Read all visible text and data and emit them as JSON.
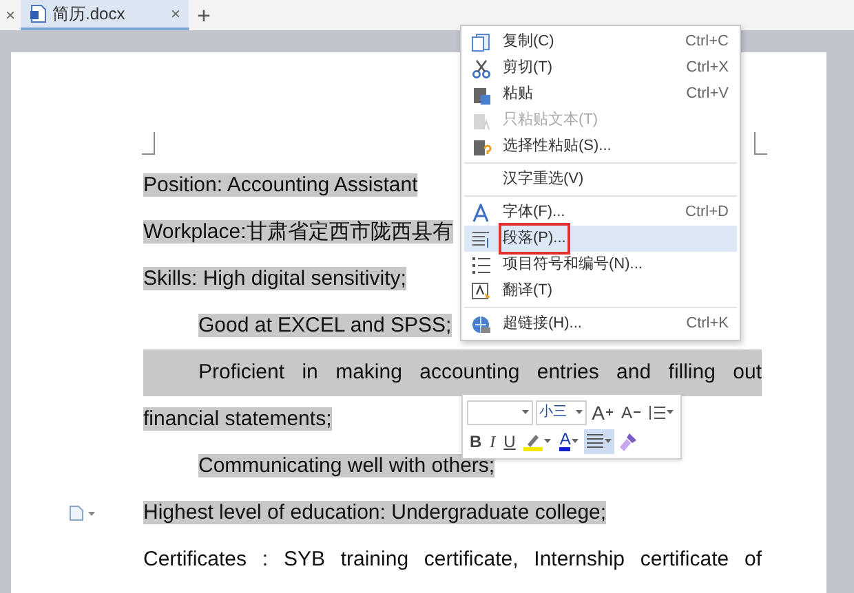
{
  "tabbar": {
    "prev_close": "×",
    "add": "+"
  },
  "tabs": [
    {
      "label": "简历.docx",
      "close": "×",
      "selected": true
    }
  ],
  "paragraphs": [
    {
      "lines": [
        {
          "text": "Position: Accounting Assistant",
          "justified": false
        }
      ],
      "selected": true,
      "indent": false,
      "marker": false
    },
    {
      "lines": [
        {
          "text": "Workplace:甘肃省定西市陇西县有",
          "justified": false
        }
      ],
      "selected": true,
      "indent": false,
      "marker": false
    },
    {
      "lines": [
        {
          "text": "Skills: High digital sensitivity;",
          "justified": false
        }
      ],
      "selected": true,
      "indent": false,
      "marker": false
    },
    {
      "lines": [
        {
          "text": "Good at EXCEL and SPSS;",
          "justified": false
        }
      ],
      "selected": true,
      "indent": true,
      "marker": false
    },
    {
      "lines": [
        {
          "text": "Proficient in making accounting entries and filling out",
          "justified": true
        },
        {
          "text": "financial statements;",
          "justified": false
        }
      ],
      "selected": true,
      "indent": true,
      "marker": false
    },
    {
      "lines": [
        {
          "text": "Communicating well with others;",
          "justified": false
        }
      ],
      "selected": true,
      "indent": true,
      "marker": false
    },
    {
      "lines": [
        {
          "text": "Highest level of education: Undergraduate college;",
          "justified": false
        }
      ],
      "selected": true,
      "indent": false,
      "marker": true
    },
    {
      "lines": [
        {
          "text": "Certificates : SYB training   certificate,   Internship certificate of",
          "justified": true
        }
      ],
      "selected": false,
      "indent": false,
      "marker": false
    }
  ],
  "context_menu": [
    {
      "kind": "copy",
      "label": "复制(C)",
      "shortcut": "Ctrl+C",
      "disabled": false,
      "selected": false,
      "separator_before": false,
      "boxed": false
    },
    {
      "kind": "cut",
      "label": "剪切(T)",
      "shortcut": "Ctrl+X",
      "disabled": false,
      "selected": false,
      "separator_before": false,
      "boxed": false
    },
    {
      "kind": "paste",
      "label": "粘贴",
      "shortcut": "Ctrl+V",
      "disabled": false,
      "selected": false,
      "separator_before": false,
      "boxed": false
    },
    {
      "kind": "paste-text",
      "label": "只粘贴文本(T)",
      "disabled": true,
      "selected": false,
      "separator_before": false,
      "boxed": false
    },
    {
      "kind": "paste-special",
      "label": "选择性粘贴(S)...",
      "disabled": false,
      "selected": false,
      "separator_before": false,
      "boxed": false
    },
    {
      "kind": "plain",
      "label": "汉字重选(V)",
      "disabled": false,
      "selected": false,
      "separator_before": true,
      "boxed": false
    },
    {
      "kind": "font",
      "label": "字体(F)...",
      "shortcut": "Ctrl+D",
      "disabled": false,
      "selected": false,
      "separator_before": true,
      "boxed": false
    },
    {
      "kind": "paragraph",
      "label": "段落(P)...",
      "disabled": false,
      "selected": true,
      "separator_before": false,
      "boxed": true
    },
    {
      "kind": "list",
      "label": "项目符号和编号(N)...",
      "disabled": false,
      "selected": false,
      "separator_before": false,
      "boxed": false
    },
    {
      "kind": "translate",
      "label": "翻译(T)",
      "disabled": false,
      "selected": false,
      "separator_before": false,
      "boxed": false
    },
    {
      "kind": "link",
      "label": "超链接(H)...",
      "shortcut": "Ctrl+K",
      "disabled": false,
      "selected": false,
      "separator_before": true,
      "boxed": false
    }
  ],
  "mini_toolbar": {
    "font_size": "小三",
    "row_1": [
      {
        "kind": "grow",
        "label": "A",
        "selected": false
      },
      {
        "kind": "shrink",
        "label": "A",
        "selected": false
      },
      {
        "kind": "spacing",
        "selected": false
      }
    ],
    "row_2": [
      {
        "kind": "bold",
        "label": "B",
        "selected": false
      },
      {
        "kind": "italic",
        "label": "I",
        "selected": false
      },
      {
        "kind": "underline",
        "label": "U",
        "selected": false
      },
      {
        "kind": "highlight",
        "selected": false
      },
      {
        "kind": "color",
        "label": "A",
        "selected": false
      },
      {
        "kind": "align",
        "selected": true
      },
      {
        "kind": "painter",
        "selected": false
      }
    ]
  }
}
